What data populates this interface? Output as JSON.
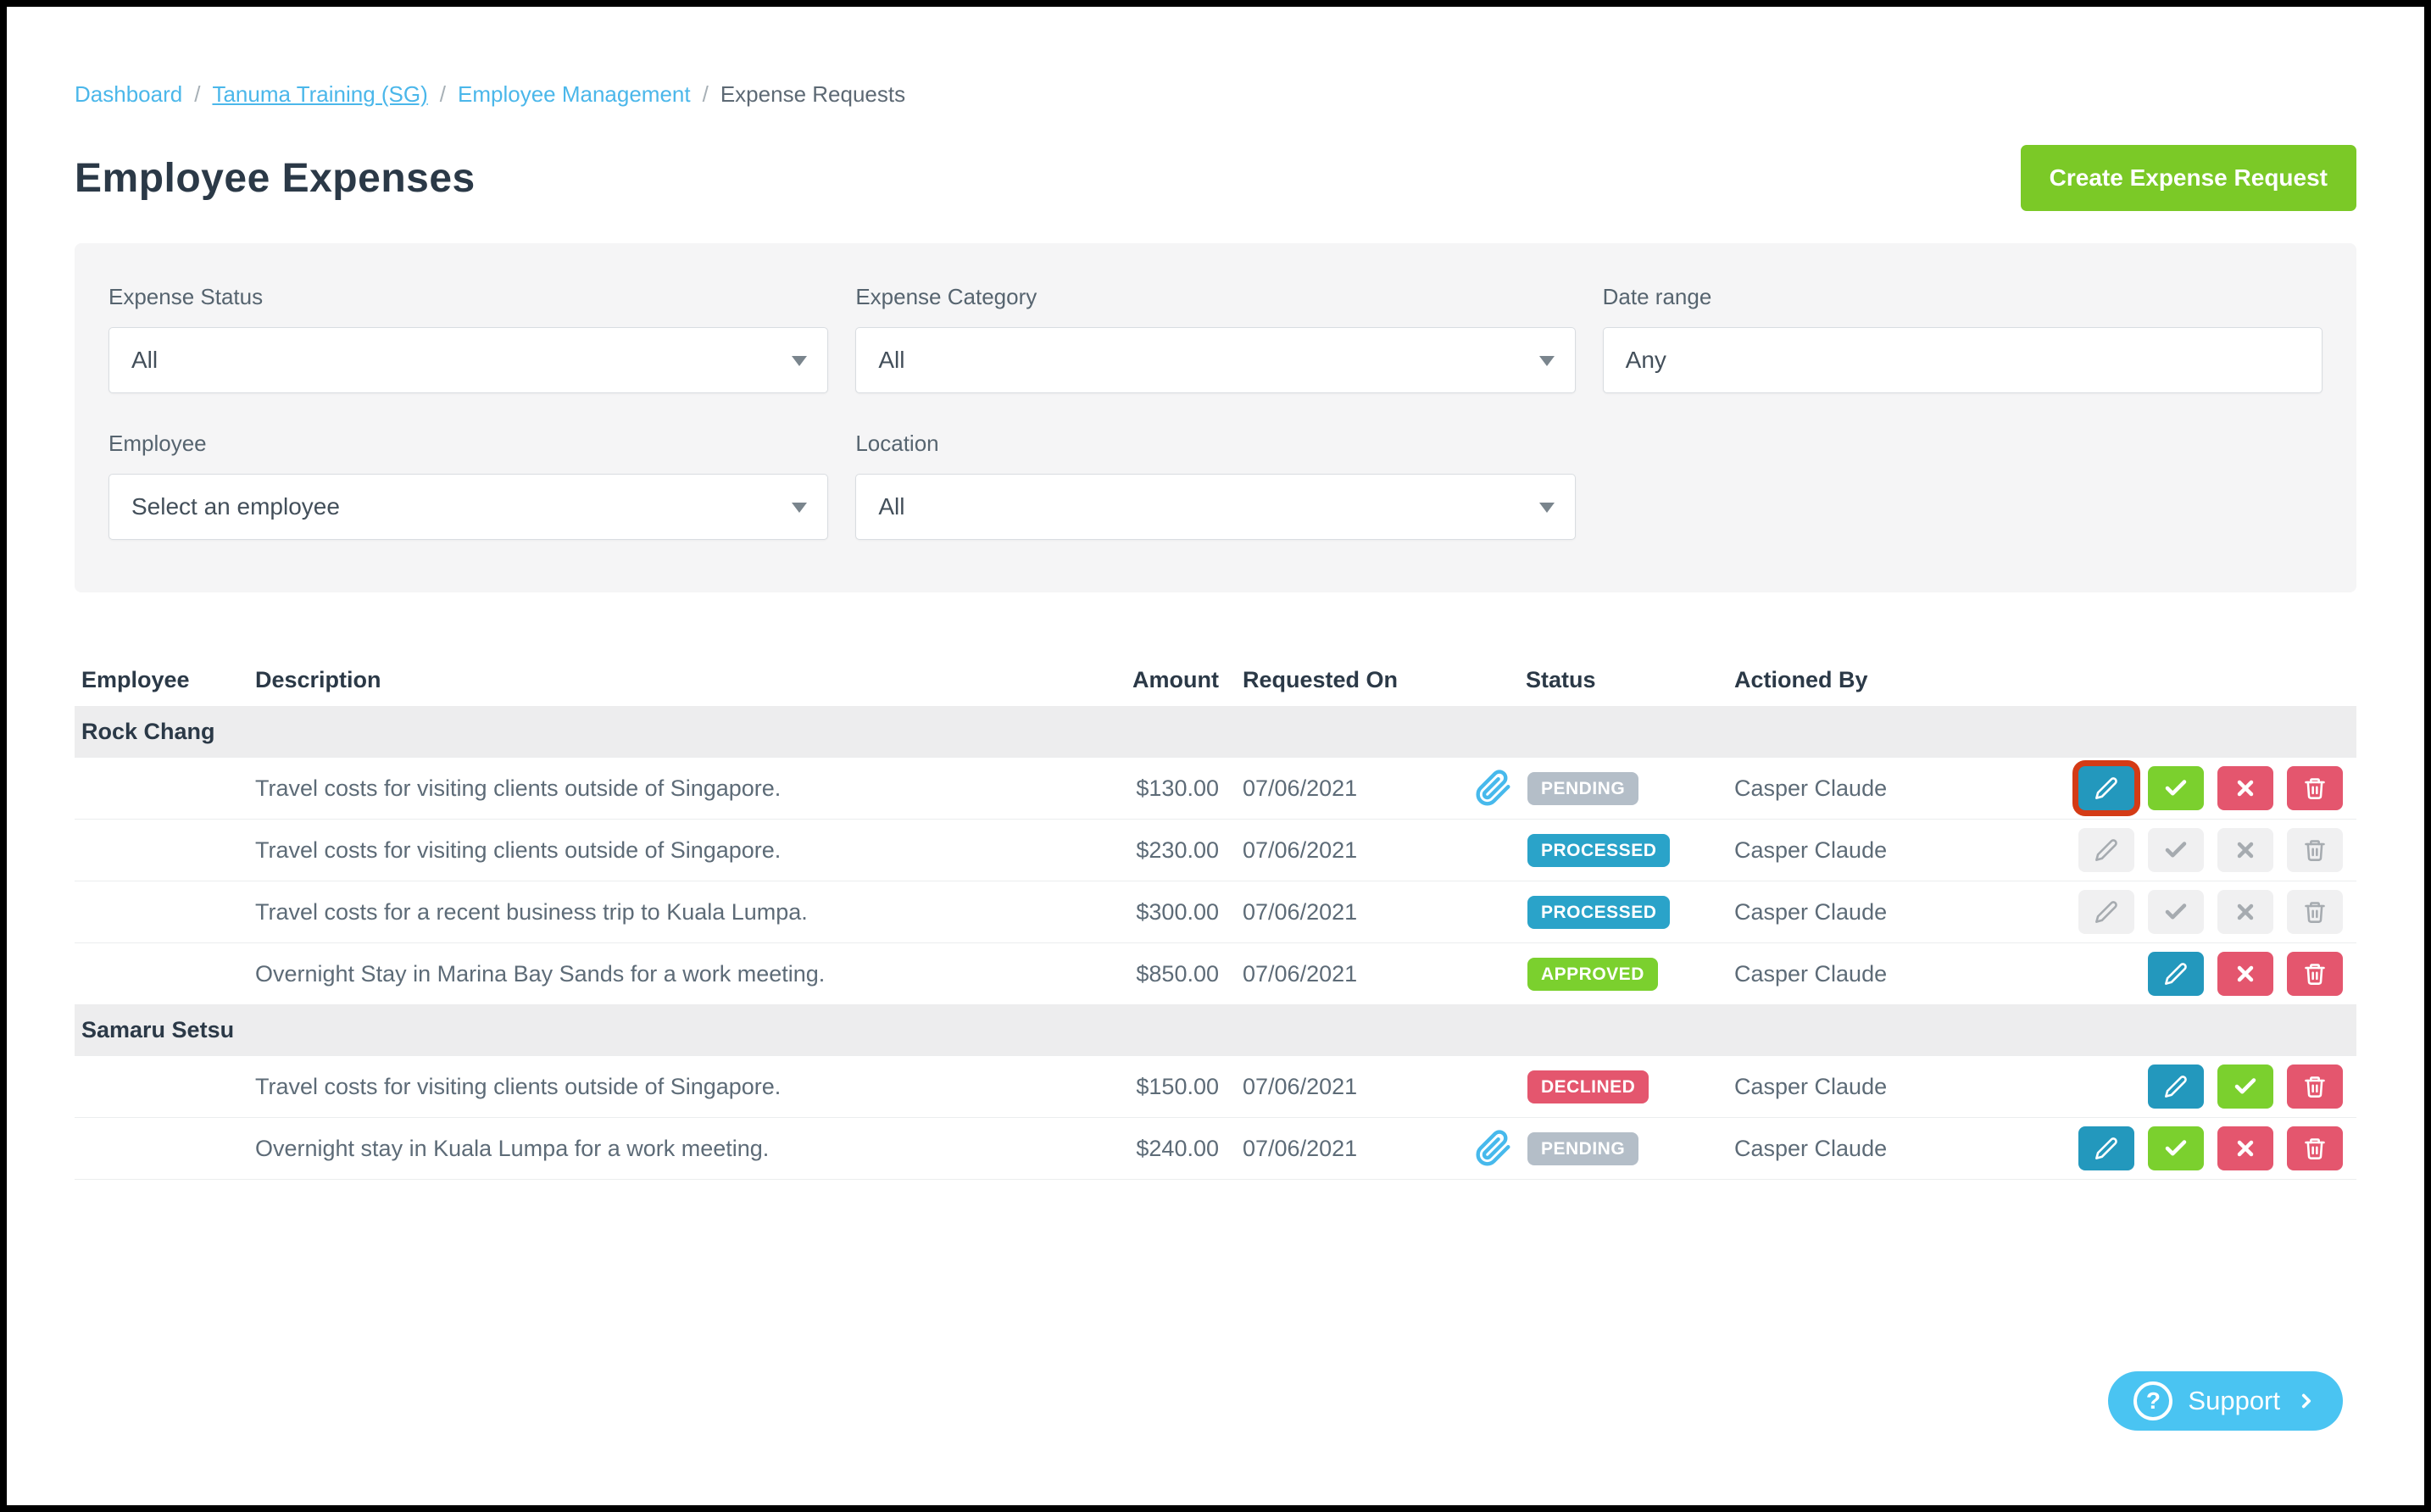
{
  "breadcrumb": {
    "items": [
      {
        "label": "Dashboard",
        "type": "link"
      },
      {
        "label": "Tanuma Training (SG)",
        "type": "link-underlined"
      },
      {
        "label": "Employee Management",
        "type": "link"
      },
      {
        "label": "Expense Requests",
        "type": "current"
      }
    ],
    "separator": "/"
  },
  "header": {
    "title": "Employee Expenses",
    "create_button_label": "Create Expense Request"
  },
  "filters": {
    "expense_status": {
      "label": "Expense Status",
      "value": "All"
    },
    "expense_category": {
      "label": "Expense Category",
      "value": "All"
    },
    "date_range": {
      "label": "Date range",
      "value": "Any"
    },
    "employee": {
      "label": "Employee",
      "value": "Select an employee"
    },
    "location": {
      "label": "Location",
      "value": "All"
    }
  },
  "table": {
    "columns": [
      "Employee",
      "Description",
      "Amount",
      "Requested On",
      "Status",
      "Actioned By"
    ],
    "groups": [
      {
        "name": "Rock Chang",
        "rows": [
          {
            "description": "Travel costs for visiting clients outside of Singapore.",
            "amount": "$130.00",
            "requested_on": "07/06/2021",
            "status": "PENDING",
            "has_attachment": true,
            "actioned_by": "Casper Claude",
            "actions_disabled": false,
            "actions": [
              {
                "type": "edit",
                "highlighted": true
              },
              {
                "type": "approve"
              },
              {
                "type": "decline"
              },
              {
                "type": "delete"
              }
            ]
          },
          {
            "description": "Travel costs for visiting clients outside of Singapore.",
            "amount": "$230.00",
            "requested_on": "07/06/2021",
            "status": "PROCESSED",
            "has_attachment": false,
            "actioned_by": "Casper Claude",
            "actions_disabled": true,
            "actions": [
              {
                "type": "edit"
              },
              {
                "type": "approve"
              },
              {
                "type": "decline"
              },
              {
                "type": "delete"
              }
            ]
          },
          {
            "description": "Travel costs for a recent business trip to Kuala Lumpa.",
            "amount": "$300.00",
            "requested_on": "07/06/2021",
            "status": "PROCESSED",
            "has_attachment": false,
            "actioned_by": "Casper Claude",
            "actions_disabled": true,
            "actions": [
              {
                "type": "edit"
              },
              {
                "type": "approve"
              },
              {
                "type": "decline"
              },
              {
                "type": "delete"
              }
            ]
          },
          {
            "description": "Overnight Stay in Marina Bay Sands for a work meeting.",
            "amount": "$850.00",
            "requested_on": "07/06/2021",
            "status": "APPROVED",
            "has_attachment": false,
            "actioned_by": "Casper Claude",
            "actions_disabled": false,
            "actions": [
              {
                "type": "edit"
              },
              {
                "type": "decline"
              },
              {
                "type": "delete"
              }
            ]
          }
        ]
      },
      {
        "name": "Samaru Setsu",
        "rows": [
          {
            "description": "Travel costs for visiting clients outside of Singapore.",
            "amount": "$150.00",
            "requested_on": "07/06/2021",
            "status": "DECLINED",
            "has_attachment": false,
            "actioned_by": "Casper Claude",
            "actions_disabled": false,
            "actions": [
              {
                "type": "edit"
              },
              {
                "type": "approve"
              },
              {
                "type": "delete"
              }
            ]
          },
          {
            "description": "Overnight stay in Kuala Lumpa for a work meeting.",
            "amount": "$240.00",
            "requested_on": "07/06/2021",
            "status": "PENDING",
            "has_attachment": true,
            "actioned_by": "Casper Claude",
            "actions_disabled": false,
            "actions": [
              {
                "type": "edit"
              },
              {
                "type": "approve"
              },
              {
                "type": "decline"
              },
              {
                "type": "delete"
              }
            ]
          }
        ]
      }
    ]
  },
  "support": {
    "label": "Support"
  },
  "colors": {
    "link_blue": "#4bb7ea",
    "create_button_green": "#7bc927",
    "badges": {
      "PENDING": "#b4bec8",
      "PROCESSED": "#2aa3c9",
      "APPROVED": "#7bd02e",
      "DECLINED": "#e4566e"
    },
    "actions": {
      "edit": "#2398bd",
      "approve": "#7bd02e",
      "decline": "#e4566e",
      "delete": "#e4566e"
    },
    "disabled_bg": "#f0f0f1",
    "disabled_icon": "#a6abb0",
    "highlight_outline": "#d43b16",
    "paperclip_blue": "#47b9ec",
    "support_blue": "#4ac4f2"
  }
}
